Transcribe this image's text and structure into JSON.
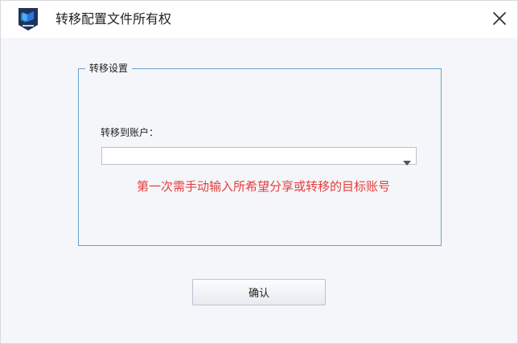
{
  "window": {
    "title": "转移配置文件所有权",
    "icon": "app-logo-icon",
    "close_icon": "close-icon"
  },
  "group": {
    "legend": "转移设置",
    "target_account": {
      "label": "转移到账户：",
      "value": "",
      "dropdown_icon": "chevron-down-icon"
    },
    "hint": "第一次需手动输入所希望分享或转移的目标账号"
  },
  "actions": {
    "confirm_label": "确认"
  },
  "colors": {
    "hint": "#e43d3d",
    "group_border": "#6fa1c9",
    "background": "#f4f6f9"
  }
}
